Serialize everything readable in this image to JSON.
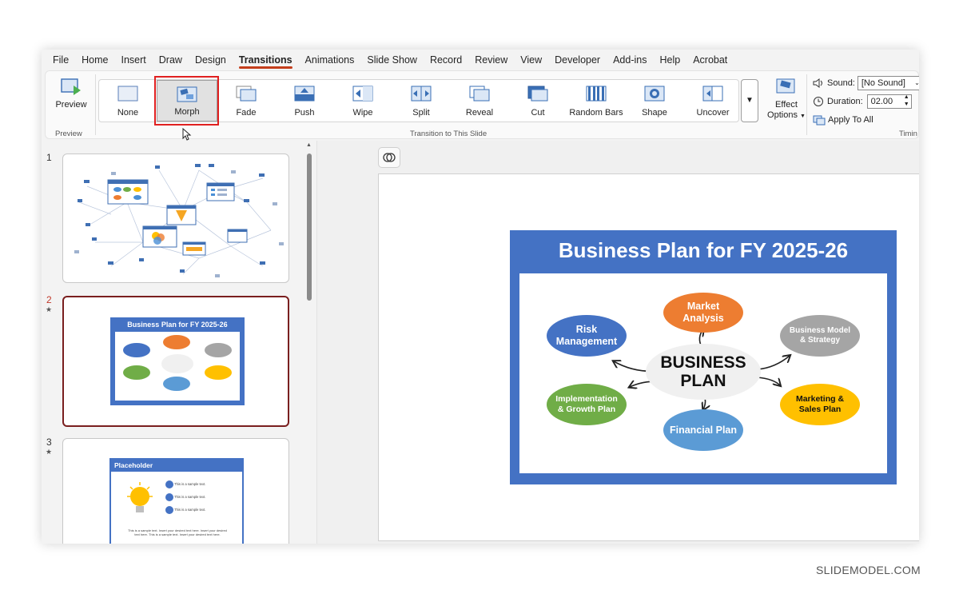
{
  "menu": {
    "tabs": [
      "File",
      "Home",
      "Insert",
      "Draw",
      "Design",
      "Transitions",
      "Animations",
      "Slide Show",
      "Record",
      "Review",
      "View",
      "Developer",
      "Add-ins",
      "Help",
      "Acrobat"
    ],
    "active": "Transitions"
  },
  "ribbon": {
    "preview_label": "Preview",
    "preview_group": "Preview",
    "transitions": [
      "None",
      "Morph",
      "Fade",
      "Push",
      "Wipe",
      "Split",
      "Reveal",
      "Cut",
      "Random Bars",
      "Shape",
      "Uncover"
    ],
    "selected_transition": "Morph",
    "gallery_group": "Transition to This Slide",
    "effect_line1": "Effect",
    "effect_line2": "Options",
    "sound_label": "Sound:",
    "sound_value": "[No Sound]",
    "duration_label": "Duration:",
    "duration_value": "02.00",
    "apply_all": "Apply To All",
    "timing_group": "Timin"
  },
  "thumbnails": {
    "slide1_num": "1",
    "slide2_num": "2",
    "slide3_num": "3",
    "star": "★",
    "slide3_title": "Placeholder",
    "sample": "This is a sample text.",
    "sample_para": "This is a sample text. Insert your desired text here. Insert your desired text here. This is a sample text. Insert your desired text here."
  },
  "slide": {
    "title": "Business Plan for FY 2025-26",
    "center_line1": "BUSINESS",
    "center_line2": "PLAN",
    "nodes": [
      {
        "key": "market",
        "l1": "Market",
        "l2": "Analysis",
        "color": "#ed7d31"
      },
      {
        "key": "risk",
        "l1": "Risk",
        "l2": "Management",
        "color": "#4472c4"
      },
      {
        "key": "model",
        "l1": "Business Model",
        "l2": "& Strategy",
        "color": "#a5a5a5"
      },
      {
        "key": "impl",
        "l1": "Implementation",
        "l2": "& Growth Plan",
        "color": "#70ad47"
      },
      {
        "key": "mkt",
        "l1": "Marketing &",
        "l2": "Sales Plan",
        "color": "#ffc000"
      },
      {
        "key": "fin",
        "l1": "Financial Plan",
        "l2": "",
        "color": "#5b9bd5"
      }
    ]
  },
  "watermark": "SLIDEMODEL.COM"
}
